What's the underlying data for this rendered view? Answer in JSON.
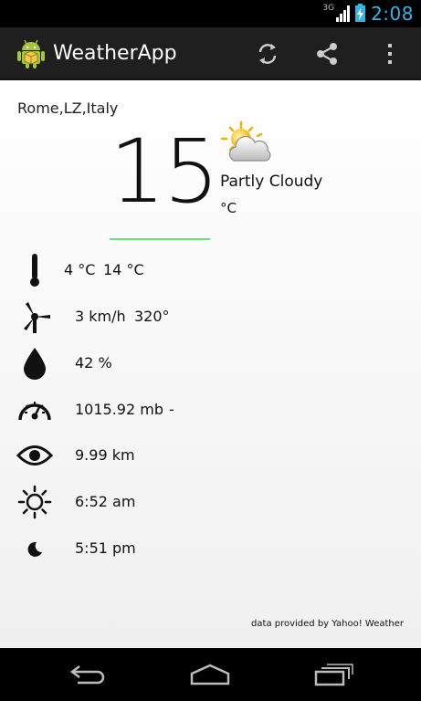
{
  "status_bar": {
    "network_type": "3G",
    "time": "2:08",
    "colors": {
      "accent": "#33b5e5"
    }
  },
  "action_bar": {
    "title": "WeatherApp",
    "icons": [
      "android-app-icon",
      "refresh-icon",
      "share-icon",
      "overflow-menu-icon"
    ]
  },
  "weather": {
    "location": "Rome,LZ,Italy",
    "temperature": "15",
    "condition": "Partly Cloudy",
    "unit": "°C",
    "condition_icon": "partly-cloudy-icon",
    "underline_color": "#6ee07a"
  },
  "details": {
    "temp_range": {
      "icon": "thermometer-icon",
      "min": "4 °C",
      "max": "14 °C"
    },
    "wind": {
      "icon": "wind-turbine-icon",
      "speed": "3 km/h",
      "direction": "320°"
    },
    "humidity": {
      "icon": "water-drop-icon",
      "value": "42 %"
    },
    "pressure": {
      "icon": "barometer-gauge-icon",
      "value": "1015.92 mb",
      "trend": "-"
    },
    "visibility": {
      "icon": "eye-icon",
      "value": "9.99 km"
    },
    "sunrise": {
      "icon": "sun-icon",
      "value": "6:52 am"
    },
    "sunset": {
      "icon": "moon-icon",
      "value": "5:51 pm"
    }
  },
  "credit": "data provided by Yahoo! Weather",
  "nav_bar": {
    "icons": [
      "back-icon",
      "home-icon",
      "recent-apps-icon"
    ]
  }
}
